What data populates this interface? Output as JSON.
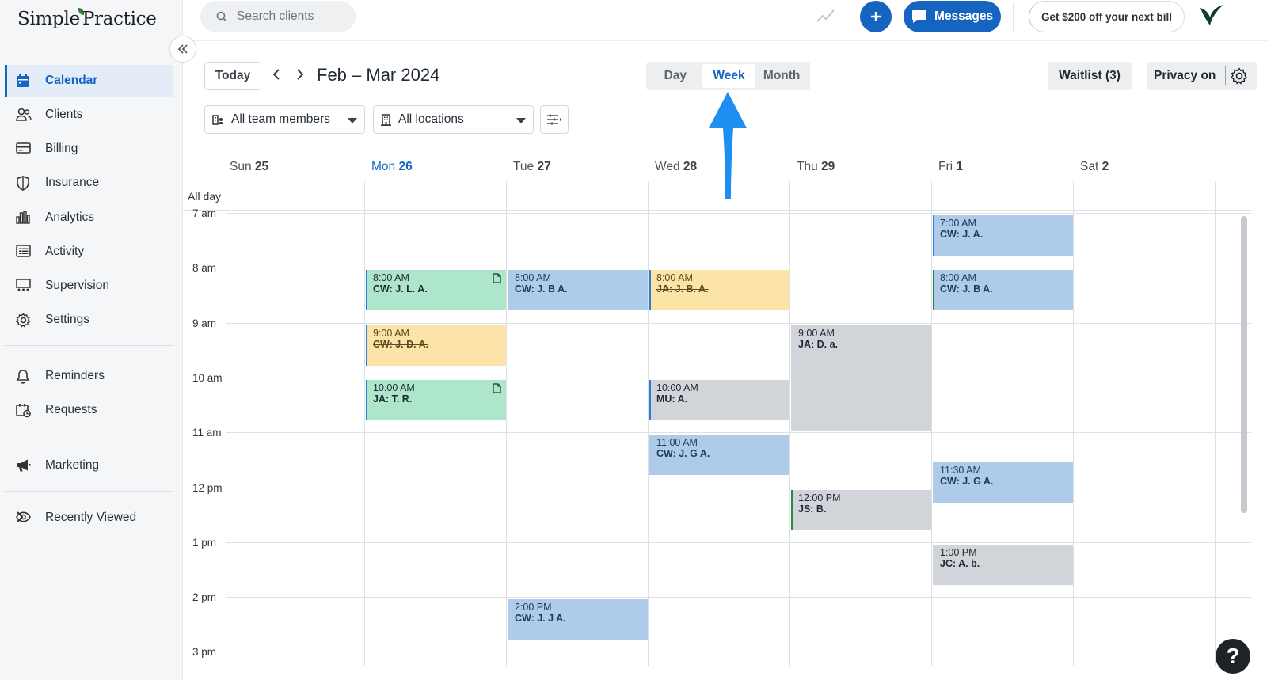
{
  "app": {
    "logo": "SimplePractice"
  },
  "search": {
    "placeholder": "Search clients"
  },
  "header": {
    "messages_label": "Messages",
    "promo_label": "Get $200 off your next bill"
  },
  "sidebar": {
    "items": [
      {
        "label": "Calendar",
        "icon": "calendar-icon",
        "active": true
      },
      {
        "label": "Clients",
        "icon": "clients-icon"
      },
      {
        "label": "Billing",
        "icon": "billing-icon"
      },
      {
        "label": "Insurance",
        "icon": "shield-icon"
      },
      {
        "label": "Analytics",
        "icon": "bar-chart-icon"
      },
      {
        "label": "Activity",
        "icon": "activity-list-icon"
      },
      {
        "label": "Supervision",
        "icon": "supervision-icon"
      },
      {
        "label": "Settings",
        "icon": "gear-icon"
      },
      {
        "label": "Reminders",
        "icon": "bell-icon"
      },
      {
        "label": "Requests",
        "icon": "calendar-clock-icon"
      },
      {
        "label": "Marketing",
        "icon": "megaphone-icon"
      },
      {
        "label": "Recently Viewed",
        "icon": "eye-icon"
      }
    ]
  },
  "calendar": {
    "today_label": "Today",
    "range_title": "Feb – Mar 2024",
    "views": [
      "Day",
      "Week",
      "Month"
    ],
    "active_view": "Week",
    "waitlist_label": "Waitlist (3)",
    "privacy_label": "Privacy on",
    "team_filter": "All team members",
    "location_filter": "All locations",
    "all_day_label": "All day",
    "days": [
      {
        "name": "Sun",
        "num": "25"
      },
      {
        "name": "Mon",
        "num": "26",
        "today": true
      },
      {
        "name": "Tue",
        "num": "27"
      },
      {
        "name": "Wed",
        "num": "28"
      },
      {
        "name": "Thu",
        "num": "29"
      },
      {
        "name": "Fri",
        "num": "1"
      },
      {
        "name": "Sat",
        "num": "2"
      }
    ],
    "hours": [
      "7 am",
      "8 am",
      "9 am",
      "10 am",
      "11 am",
      "12 pm",
      "1 pm",
      "2 pm",
      "3 pm"
    ],
    "events": [
      {
        "day": 1,
        "start": 8,
        "end": 8.75,
        "time": "8:00 AM",
        "name": "CW: J. L. A.",
        "color": "green",
        "doc": true
      },
      {
        "day": 1,
        "start": 9,
        "end": 9.75,
        "time": "9:00 AM",
        "name": "CW: J. D. A.",
        "color": "yellow",
        "cancelled": true
      },
      {
        "day": 1,
        "start": 10,
        "end": 10.75,
        "time": "10:00 AM",
        "name": "JA: T. R.",
        "color": "green",
        "doc": true
      },
      {
        "day": 2,
        "start": 8,
        "end": 8.75,
        "time": "8:00 AM",
        "name": "CW: J. B A.",
        "color": "blue"
      },
      {
        "day": 2,
        "start": 14,
        "end": 14.75,
        "time": "2:00 PM",
        "name": "CW: J. J A.",
        "color": "blue"
      },
      {
        "day": 3,
        "start": 8,
        "end": 8.75,
        "time": "8:00 AM",
        "name": "JA: J. B. A.",
        "color": "yellow",
        "cancelled": true
      },
      {
        "day": 3,
        "start": 10,
        "end": 10.75,
        "time": "10:00 AM",
        "name": "MU: A.",
        "color": "gray",
        "left": "blue"
      },
      {
        "day": 3,
        "start": 11,
        "end": 11.75,
        "time": "11:00 AM",
        "name": "CW: J. G A.",
        "color": "blue"
      },
      {
        "day": 4,
        "start": 9,
        "end": 10.95,
        "time": "9:00 AM",
        "name": "JA: D. a.",
        "color": "gray"
      },
      {
        "day": 4,
        "start": 12,
        "end": 12.75,
        "time": "12:00 PM",
        "name": "JS: B.",
        "color": "gray",
        "left": "green"
      },
      {
        "day": 5,
        "start": 7,
        "end": 7.75,
        "time": "7:00 AM",
        "name": "CW: J. A.",
        "color": "blue",
        "left": "blue"
      },
      {
        "day": 5,
        "start": 8,
        "end": 8.75,
        "time": "8:00 AM",
        "name": "CW: J. B A.",
        "color": "blue",
        "left": "green"
      },
      {
        "day": 5,
        "start": 11.5,
        "end": 12.25,
        "time": "11:30 AM",
        "name": "CW: J. G A.",
        "color": "blue"
      },
      {
        "day": 5,
        "start": 13,
        "end": 13.75,
        "time": "1:00 PM",
        "name": "JC: A. b.",
        "color": "gray"
      }
    ]
  },
  "help": {
    "label": "?"
  }
}
